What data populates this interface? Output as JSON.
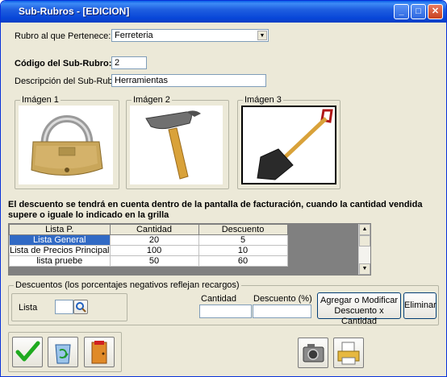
{
  "window": {
    "title": "Sub-Rubros - [EDICION]"
  },
  "form": {
    "rubro_label": "Rubro al que Pertenece:",
    "rubro_value": "Ferreteria",
    "codigo_label": "Código del Sub-Rubro:",
    "codigo_value": "2",
    "descripcion_label": "Descripción del Sub-Rubro:",
    "descripcion_value": "Herramientas"
  },
  "images": [
    {
      "label": "Imágen 1",
      "icon": "padlock-image"
    },
    {
      "label": "Imágen 2",
      "icon": "hammer-image"
    },
    {
      "label": "Imágen 3",
      "icon": "shovel-image"
    }
  ],
  "notice": "El descuento se tendrá en cuenta dentro de la pantalla de facturación, cuando la cantidad vendida supere o iguale lo indicado en la grilla",
  "grid": {
    "columns": [
      "Lista P.",
      "Cantidad",
      "Descuento"
    ],
    "rows": [
      [
        "Lista General",
        "20",
        "5"
      ],
      [
        "Lista de Precios Principal",
        "100",
        "10"
      ],
      [
        "lista pruebe",
        "50",
        "60"
      ]
    ]
  },
  "descuentos": {
    "group_label": "Descuentos (los porcentajes negativos reflejan recargos)",
    "lista_label": "Lista",
    "cantidad_label": "Cantidad",
    "descuento_label": "Descuento (%)",
    "add_button": "Agregar o Modificar Descuento x Cantidad",
    "delete_button": "Eliminar"
  },
  "toolbar": {
    "accept_icon": "checkmark-icon",
    "recycle_icon": "recycle-bin-icon",
    "exit_icon": "exit-door-icon",
    "camera_icon": "camera-icon",
    "print_icon": "printer-icon"
  },
  "colors": {
    "selected": "#316ac5",
    "titlebar": "#0846d8"
  }
}
